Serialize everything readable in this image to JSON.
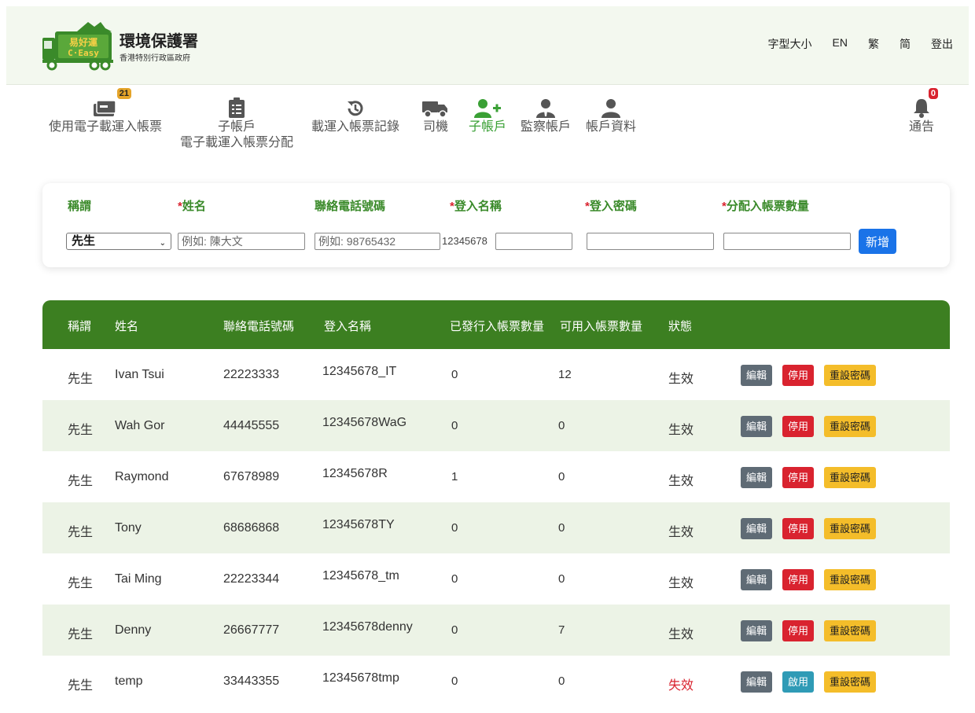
{
  "header": {
    "logo_text_top": "易好運",
    "logo_text_bottom": "C·Easy",
    "org_title": "環境保護署",
    "org_subtitle": "香港特別行政區政府",
    "links": [
      "字型大小",
      "EN",
      "繁",
      "简",
      "登出"
    ]
  },
  "nav": {
    "items": [
      {
        "label": "使用電子載運入帳票",
        "label2": "",
        "icon": "ticket-icon",
        "badge": "21"
      },
      {
        "label": "子帳戶",
        "label2": "電子載運入帳票分配",
        "icon": "clipboard-list-icon",
        "badge": ""
      },
      {
        "label": "載運入帳票記錄",
        "label2": "",
        "icon": "history-icon",
        "badge": ""
      },
      {
        "label": "司機",
        "label2": "",
        "icon": "truck-icon",
        "badge": ""
      },
      {
        "label": "子帳戶",
        "label2": "",
        "icon": "user-plus-icon",
        "badge": ""
      },
      {
        "label": "監察帳戶",
        "label2": "",
        "icon": "user-tie-icon",
        "badge": ""
      },
      {
        "label": "帳戶資料",
        "label2": "",
        "icon": "user-icon",
        "badge": ""
      }
    ],
    "notify": {
      "label": "通告",
      "badge": "0"
    }
  },
  "form": {
    "labels": {
      "title": "稱謂",
      "name": "姓名",
      "phone": "聯絡電話號碼",
      "login": "登入名稱",
      "password": "登入密碼",
      "quota": "分配入帳票數量"
    },
    "required_mark": "*",
    "title_value": "先生",
    "name_placeholder": "例如: 陳大文",
    "phone_placeholder": "例如: 98765432",
    "login_prefix": "12345678",
    "add_label": "新增"
  },
  "table": {
    "columns": [
      "稱謂",
      "姓名",
      "聯絡電話號碼",
      "登入名稱",
      "已發行入帳票數量",
      "可用入帳票數量",
      "狀態"
    ],
    "actions": {
      "edit": "編輯",
      "disable": "停用",
      "enable": "啟用",
      "reset": "重設密碼"
    },
    "rows": [
      {
        "title": "先生",
        "name": "Ivan Tsui",
        "phone": "22223333",
        "login": "12345678_IT",
        "issued": "0",
        "available": "12",
        "status": "生效",
        "active": true
      },
      {
        "title": "先生",
        "name": "Wah Gor",
        "phone": "44445555",
        "login": "12345678WaG",
        "issued": "0",
        "available": "0",
        "status": "生效",
        "active": true
      },
      {
        "title": "先生",
        "name": "Raymond",
        "phone": "67678989",
        "login": "12345678R",
        "issued": "1",
        "available": "0",
        "status": "生效",
        "active": true
      },
      {
        "title": "先生",
        "name": "Tony",
        "phone": "68686868",
        "login": "12345678TY",
        "issued": "0",
        "available": "0",
        "status": "生效",
        "active": true
      },
      {
        "title": "先生",
        "name": "Tai Ming",
        "phone": "22223344",
        "login": "12345678_tm",
        "issued": "0",
        "available": "0",
        "status": "生效",
        "active": true
      },
      {
        "title": "先生",
        "name": "Denny",
        "phone": "26667777",
        "login": "12345678denny",
        "issued": "0",
        "available": "7",
        "status": "生效",
        "active": true
      },
      {
        "title": "先生",
        "name": "temp",
        "phone": "33443355",
        "login": "12345678tmp",
        "issued": "0",
        "available": "0",
        "status": "失效",
        "active": false
      }
    ]
  },
  "colors": {
    "header_bg": "#f3f8ef",
    "table_head": "#3c7f21",
    "label_green": "#3a8a2a",
    "active_nav": "#3aa035",
    "danger": "#d9232f",
    "primary": "#1a73e8",
    "warning": "#f4bd2a",
    "info": "#2f9bb6",
    "secondary": "#5f6b75"
  }
}
